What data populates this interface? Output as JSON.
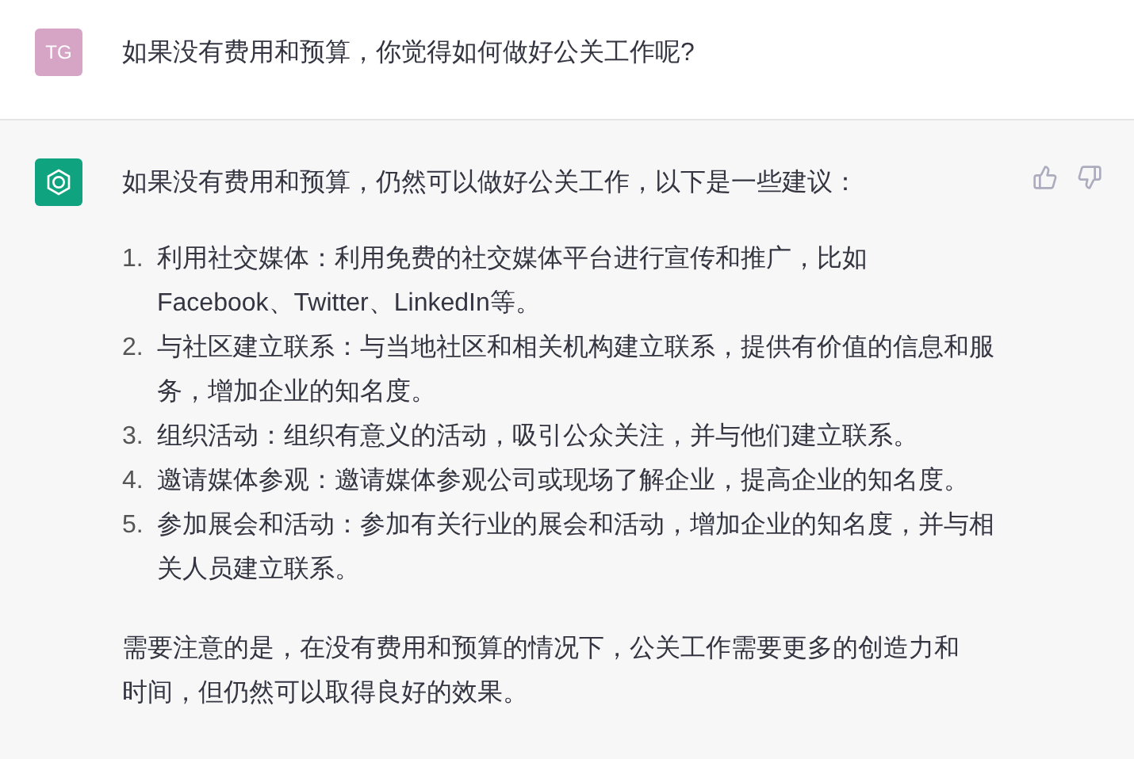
{
  "user_message": {
    "avatar": "TG",
    "text": "如果没有费用和预算，你觉得如何做好公关工作呢?"
  },
  "assistant_message": {
    "intro": "如果没有费用和预算，仍然可以做好公关工作，以下是一些建议：",
    "items": [
      {
        "number": "1.",
        "text": "利用社交媒体：利用免费的社交媒体平台进行宣传和推广，比如Facebook、Twitter、LinkedIn等。"
      },
      {
        "number": "2.",
        "text": "与社区建立联系：与当地社区和相关机构建立联系，提供有价值的信息和服务，增加企业的知名度。"
      },
      {
        "number": "3.",
        "text": "组织活动：组织有意义的活动，吸引公众关注，并与他们建立联系。"
      },
      {
        "number": "4.",
        "text": "邀请媒体参观：邀请媒体参观公司或现场了解企业，提高企业的知名度。"
      },
      {
        "number": "5.",
        "text": "参加展会和活动：参加有关行业的展会和活动，增加企业的知名度，并与相关人员建立联系。"
      }
    ],
    "conclusion": "需要注意的是，在没有费用和预算的情况下，公关工作需要更多的创造力和时间，但仍然可以取得良好的效果。"
  }
}
